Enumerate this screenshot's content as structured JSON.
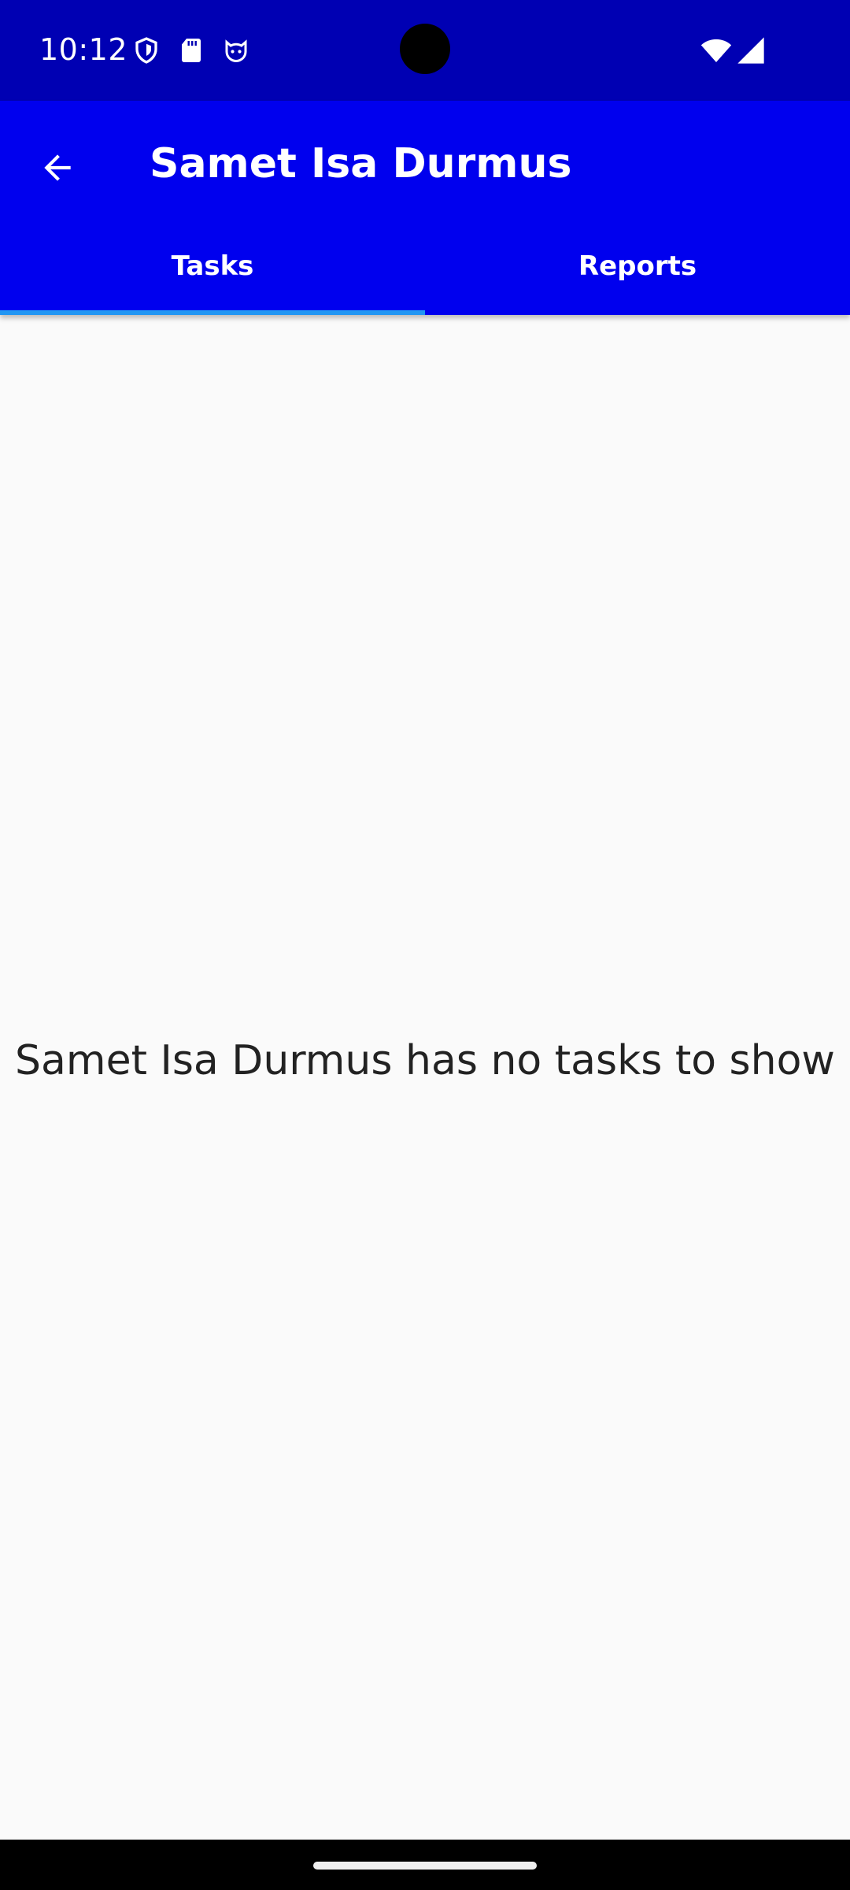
{
  "status_bar": {
    "time": "10:12",
    "left_icons": [
      "shield-icon",
      "sd-card-icon",
      "cat-face-icon"
    ],
    "right_icons": [
      "wifi-icon",
      "cell-signal-icon"
    ]
  },
  "app_bar": {
    "back_icon": "arrow-back-icon",
    "title": "Samet Isa Durmus",
    "color": "#0000ee"
  },
  "tabs": [
    {
      "label": "Tasks",
      "selected": true
    },
    {
      "label": "Reports",
      "selected": false
    }
  ],
  "tab_indicator_color": "#2196f3",
  "content": {
    "empty_message": "Samet Isa Durmus has no tasks to show"
  }
}
